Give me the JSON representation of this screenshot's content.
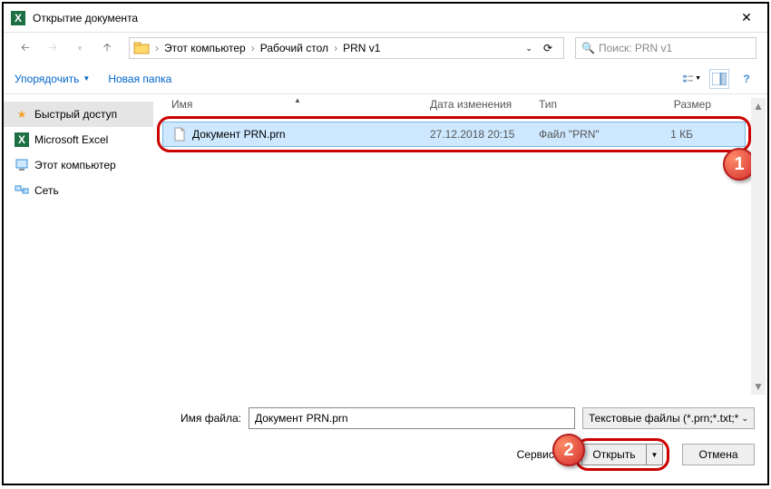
{
  "title": "Открытие документа",
  "nav": {
    "path": [
      "Этот компьютер",
      "Рабочий стол",
      "PRN v1"
    ],
    "search_placeholder": "Поиск: PRN v1"
  },
  "toolbar": {
    "organize": "Упорядочить",
    "newfolder": "Новая папка"
  },
  "sidebar": [
    {
      "label": "Быстрый доступ",
      "color": "#f0a030",
      "selected": true
    },
    {
      "label": "Microsoft Excel",
      "color": "#1d7044",
      "selected": false
    },
    {
      "label": "Этот компьютер",
      "color": "#3a8fd4",
      "selected": false
    },
    {
      "label": "Сеть",
      "color": "#3a8fd4",
      "selected": false
    }
  ],
  "columns": {
    "name": "Имя",
    "date": "Дата изменения",
    "type": "Тип",
    "size": "Размер"
  },
  "file": {
    "name": "Документ PRN.prn",
    "date": "27.12.2018 20:15",
    "type": "Файл \"PRN\"",
    "size": "1 КБ"
  },
  "footer": {
    "filename_label": "Имя файла:",
    "filename_value": "Документ PRN.prn",
    "filetype": "Текстовые файлы (*.prn;*.txt;*",
    "service": "Сервис",
    "open": "Открыть",
    "cancel": "Отмена"
  },
  "badges": {
    "one": "1",
    "two": "2"
  }
}
